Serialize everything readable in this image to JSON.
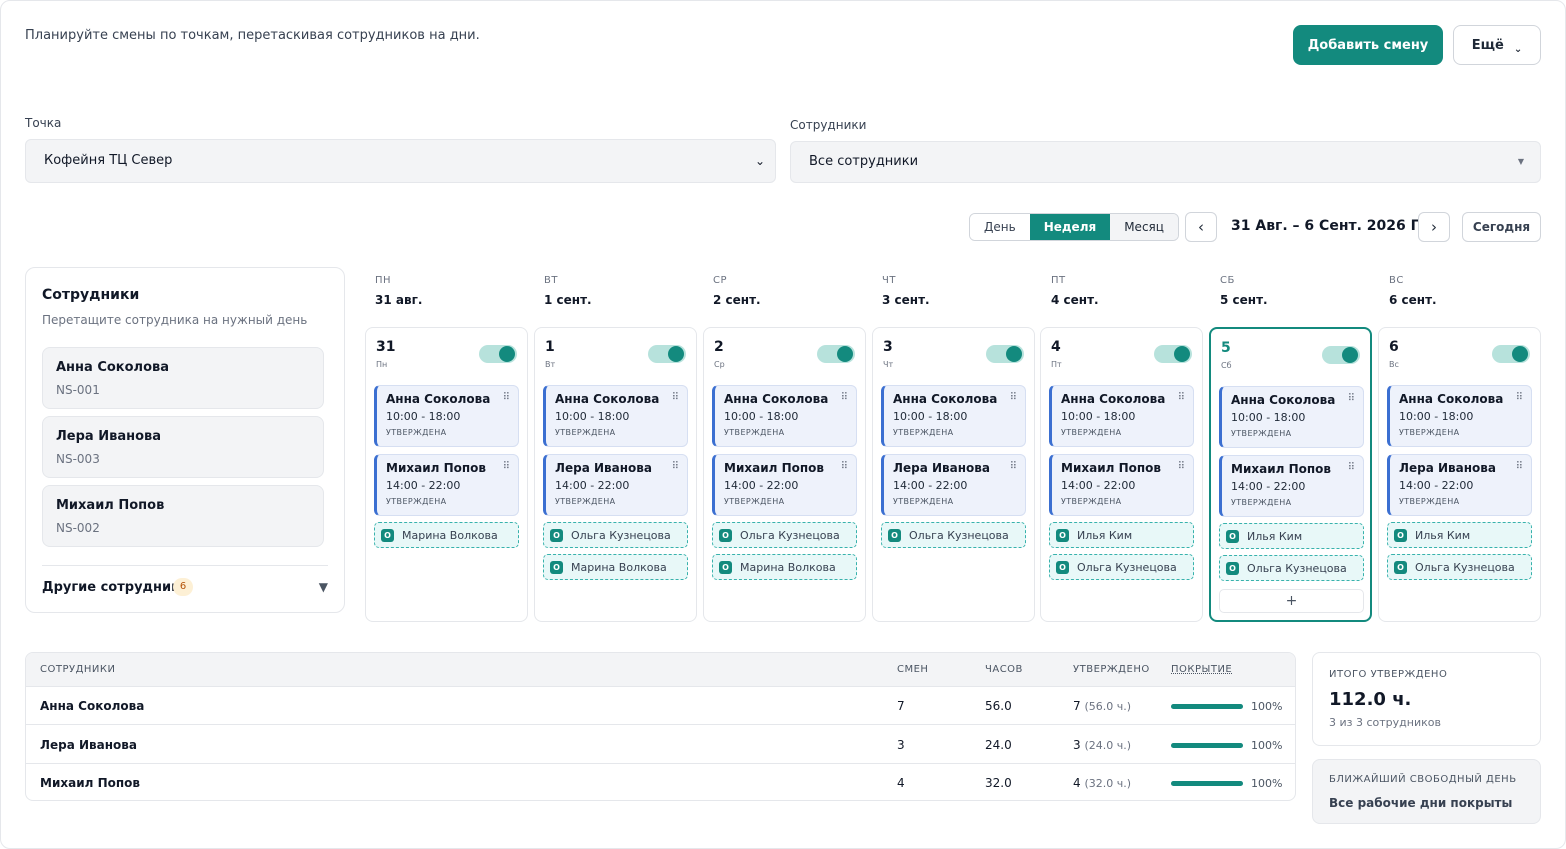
{
  "header": {
    "subtitle": "Планируйте смены по точкам, перетаскивая сотрудников на дни.",
    "add_shift_label": "Добавить смену",
    "more_label": "Ещё",
    "more_icon": "chevron-down-icon"
  },
  "filters": {
    "point_label": "Точка",
    "point_value": "Кофейня ТЦ Север",
    "employees_label": "Сотрудники",
    "employees_value": "Все сотрудники"
  },
  "view": {
    "modes": [
      "День",
      "Неделя",
      "Месяц"
    ],
    "active_mode": "Неделя",
    "prev": "‹",
    "next": "›",
    "range": "31 Авг. – 6 Сент. 2026 Г.",
    "today": "Сегодня"
  },
  "employees_panel": {
    "title": "Сотрудники",
    "hint": "Перетащите сотрудника на нужный день",
    "items": [
      {
        "name": "Анна Соколова",
        "code": "NS-001"
      },
      {
        "name": "Лера Иванова",
        "code": "NS-003"
      },
      {
        "name": "Михаил Попов",
        "code": "NS-002"
      }
    ],
    "other_label": "Другие сотрудники",
    "other_count": "6"
  },
  "days": [
    {
      "head_name": "ПН",
      "head_date": "31 авг.",
      "num": "31",
      "wd": "Пн",
      "shifts": [
        {
          "name": "Анна Соколова",
          "time": "10:00 - 18:00",
          "status": "УТВЕРЖДЕНА"
        },
        {
          "name": "Михаил Попов",
          "time": "14:00 - 22:00",
          "status": "УТВЕРЖДЕНА"
        }
      ],
      "available": [
        "Марина Волкова"
      ],
      "add": false
    },
    {
      "head_name": "ВТ",
      "head_date": "1 сент.",
      "num": "1",
      "wd": "Вт",
      "shifts": [
        {
          "name": "Анна Соколова",
          "time": "10:00 - 18:00",
          "status": "УТВЕРЖДЕНА"
        },
        {
          "name": "Лера Иванова",
          "time": "14:00 - 22:00",
          "status": "УТВЕРЖДЕНА"
        }
      ],
      "available": [
        "Ольга Кузнецова",
        "Марина Волкова"
      ],
      "add": false
    },
    {
      "head_name": "СР",
      "head_date": "2 сент.",
      "num": "2",
      "wd": "Ср",
      "shifts": [
        {
          "name": "Анна Соколова",
          "time": "10:00 - 18:00",
          "status": "УТВЕРЖДЕНА"
        },
        {
          "name": "Михаил Попов",
          "time": "14:00 - 22:00",
          "status": "УТВЕРЖДЕНА"
        }
      ],
      "available": [
        "Ольга Кузнецова",
        "Марина Волкова"
      ],
      "add": false
    },
    {
      "head_name": "ЧТ",
      "head_date": "3 сент.",
      "num": "3",
      "wd": "Чт",
      "shifts": [
        {
          "name": "Анна Соколова",
          "time": "10:00 - 18:00",
          "status": "УТВЕРЖДЕНА"
        },
        {
          "name": "Лера Иванова",
          "time": "14:00 - 22:00",
          "status": "УТВЕРЖДЕНА"
        }
      ],
      "available": [
        "Ольга Кузнецова"
      ],
      "add": false
    },
    {
      "head_name": "ПТ",
      "head_date": "4 сент.",
      "num": "4",
      "wd": "Пт",
      "shifts": [
        {
          "name": "Анна Соколова",
          "time": "10:00 - 18:00",
          "status": "УТВЕРЖДЕНА"
        },
        {
          "name": "Михаил Попов",
          "time": "14:00 - 22:00",
          "status": "УТВЕРЖДЕНА"
        }
      ],
      "available": [
        "Илья Ким",
        "Ольга Кузнецова"
      ],
      "add": false
    },
    {
      "head_name": "СБ",
      "head_date": "5 сент.",
      "num": "5",
      "wd": "Сб",
      "shifts": [
        {
          "name": "Анна Соколова",
          "time": "10:00 - 18:00",
          "status": "УТВЕРЖДЕНА"
        },
        {
          "name": "Михаил Попов",
          "time": "14:00 - 22:00",
          "status": "УТВЕРЖДЕНА"
        }
      ],
      "available": [
        "Илья Ким",
        "Ольга Кузнецова"
      ],
      "add": true,
      "selected": true
    },
    {
      "head_name": "ВС",
      "head_date": "6 сент.",
      "num": "6",
      "wd": "Вс",
      "shifts": [
        {
          "name": "Анна Соколова",
          "time": "10:00 - 18:00",
          "status": "УТВЕРЖДЕНА"
        },
        {
          "name": "Лера Иванова",
          "time": "14:00 - 22:00",
          "status": "УТВЕРЖДЕНА"
        }
      ],
      "available": [
        "Илья Ким",
        "Ольга Кузнецова"
      ],
      "add": false
    }
  ],
  "available_badge": "О",
  "add_symbol": "+",
  "table": {
    "headers": [
      "СОТРУДНИКИ",
      "СМЕН",
      "ЧАСОВ",
      "УТВЕРЖДЕНО",
      "ПОКРЫТИЕ"
    ],
    "rows": [
      {
        "name": "Анна Соколова",
        "shifts": "7",
        "hours": "56.0",
        "approved": "7",
        "approved_hours": "(56.0 ч.)",
        "coverage": 100,
        "coverage_label": "100%"
      },
      {
        "name": "Лера Иванова",
        "shifts": "3",
        "hours": "24.0",
        "approved": "3",
        "approved_hours": "(24.0 ч.)",
        "coverage": 100,
        "coverage_label": "100%"
      },
      {
        "name": "Михаил Попов",
        "shifts": "4",
        "hours": "32.0",
        "approved": "4",
        "approved_hours": "(32.0 ч.)",
        "coverage": 100,
        "coverage_label": "100%"
      }
    ]
  },
  "summary": {
    "title": "ИТОГО УТВЕРЖДЕНО",
    "value": "112.0 ч.",
    "sub": "3 из 3 сотрудников"
  },
  "next_free": {
    "title": "БЛИЖАЙШИЙ СВОБОДНЫЙ ДЕНЬ",
    "value": "Все рабочие дни покрыты"
  },
  "colors": {
    "accent": "#138a7e",
    "shift_border": "#3b6fd1"
  }
}
